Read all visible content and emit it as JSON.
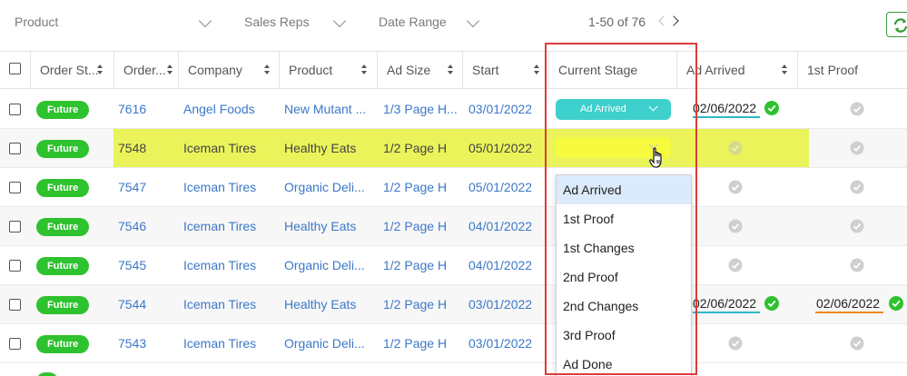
{
  "filters": {
    "product": "Product",
    "sales_reps": "Sales Reps",
    "date_range": "Date Range"
  },
  "pagination": {
    "label": "1-50 of 76"
  },
  "columns": {
    "order_status": "Order St...",
    "order_num": "Order...",
    "company": "Company",
    "product": "Product",
    "ad_size": "Ad Size",
    "start": "Start",
    "current_stage": "Current Stage",
    "ad_arrived": "Ad Arrived",
    "first_proof": "1st Proof"
  },
  "rows": [
    {
      "status": "Future",
      "order": "7616",
      "company": "Angel Foods",
      "product": "New Mutant ...",
      "ad_size": "1/3 Page H...",
      "start": "03/01/2022",
      "stage": "Ad Arrived",
      "ad_arrived": "02/06/2022",
      "first_proof": ""
    },
    {
      "status": "Future",
      "order": "7548",
      "company": "Iceman Tires",
      "product": "Healthy Eats",
      "ad_size": "1/2 Page H",
      "start": "05/01/2022",
      "stage": "",
      "ad_arrived": "",
      "first_proof": ""
    },
    {
      "status": "Future",
      "order": "7547",
      "company": "Iceman Tires",
      "product": "Organic Deli...",
      "ad_size": "1/2 Page H",
      "start": "05/01/2022",
      "stage": "",
      "ad_arrived": "",
      "first_proof": ""
    },
    {
      "status": "Future",
      "order": "7546",
      "company": "Iceman Tires",
      "product": "Healthy Eats",
      "ad_size": "1/2 Page H",
      "start": "04/01/2022",
      "stage": "",
      "ad_arrived": "",
      "first_proof": ""
    },
    {
      "status": "Future",
      "order": "7545",
      "company": "Iceman Tires",
      "product": "Organic Deli...",
      "ad_size": "1/2 Page H",
      "start": "04/01/2022",
      "stage": "",
      "ad_arrived": "",
      "first_proof": ""
    },
    {
      "status": "Future",
      "order": "7544",
      "company": "Iceman Tires",
      "product": "Healthy Eats",
      "ad_size": "1/2 Page H",
      "start": "03/01/2022",
      "stage": "",
      "ad_arrived": "02/06/2022",
      "first_proof": "02/06/2022"
    },
    {
      "status": "Future",
      "order": "7543",
      "company": "Iceman Tires",
      "product": "Organic Deli...",
      "ad_size": "1/2 Page H",
      "start": "03/01/2022",
      "stage": "",
      "ad_arrived": "",
      "first_proof": ""
    }
  ],
  "stage_dropdown": {
    "options": [
      "Ad Arrived",
      "1st Proof",
      "1st Changes",
      "2nd Proof",
      "2nd Changes",
      "3rd Proof",
      "Ad Done"
    ],
    "highlighted": "Ad Arrived"
  },
  "colors": {
    "status_green": "#2ec22e",
    "link_blue": "#3c78c8",
    "stage_teal": "#3ed0cc",
    "highlight_yellow": "#eaf45a",
    "check_green": "#2ec22e",
    "check_gray": "#cfcfcf",
    "underline_teal": "#2fb8c8",
    "underline_orange": "#f08a24",
    "annotation_red": "#e03a3a"
  },
  "icons": {
    "filter_dropdown": "chevron-down-icon",
    "sort": "sort-icon",
    "pager_prev": "chevron-left-icon",
    "pager_next": "chevron-right-icon",
    "refresh": "refresh-icon",
    "done": "check-circle-icon",
    "pending": "check-circle-gray-icon",
    "cursor": "hand-pointer-icon"
  }
}
